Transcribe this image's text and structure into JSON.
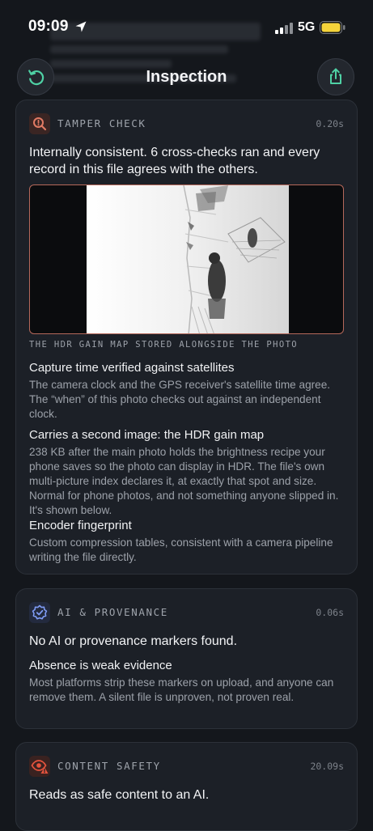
{
  "status": {
    "time": "09:09",
    "network": "5G"
  },
  "header": {
    "title": "Inspection"
  },
  "cards": {
    "tamper": {
      "label": "TAMPER CHECK",
      "time": "0.20s",
      "summary": "Internally consistent. 6 cross-checks ran and every record in this file agrees with the others.",
      "caption": "THE HDR GAIN MAP STORED ALONGSIDE THE PHOTO",
      "items": [
        {
          "title": "Capture time verified against satellites",
          "body": "The camera clock and the GPS receiver's satellite time agree. The “when” of this photo checks out against an independent clock."
        },
        {
          "title": "Carries a second image: the HDR gain map",
          "body": "238 KB after the main photo holds the brightness recipe your phone saves so the photo can display in HDR. The file's own multi-picture index declares it, at exactly that spot and size. Normal for phone photos, and not something anyone slipped in. It's shown below."
        },
        {
          "title": "Encoder fingerprint",
          "body": "Custom compression tables, consistent with a camera pipeline writing the file directly."
        }
      ]
    },
    "ai": {
      "label": "AI & PROVENANCE",
      "time": "0.06s",
      "summary": "No AI or provenance markers found.",
      "items": [
        {
          "title": "Absence is weak evidence",
          "body": "Most platforms strip these markers on upload, and anyone can remove them. A silent file is unproven, not proven real."
        }
      ]
    },
    "safety": {
      "label": "CONTENT SAFETY",
      "time": "20.09s",
      "summary": "Reads as safe content to an AI."
    }
  },
  "icons": {
    "back": "refresh-back-icon",
    "share": "share-icon",
    "tamper": "magnifier-alert-icon",
    "ai": "verified-badge-icon",
    "safety": "eye-warning-icon"
  },
  "colors": {
    "accent": "#4fd1a5",
    "tamper": "#e07a64",
    "ai": "#7f9cf5",
    "safety": "#e5533d"
  }
}
